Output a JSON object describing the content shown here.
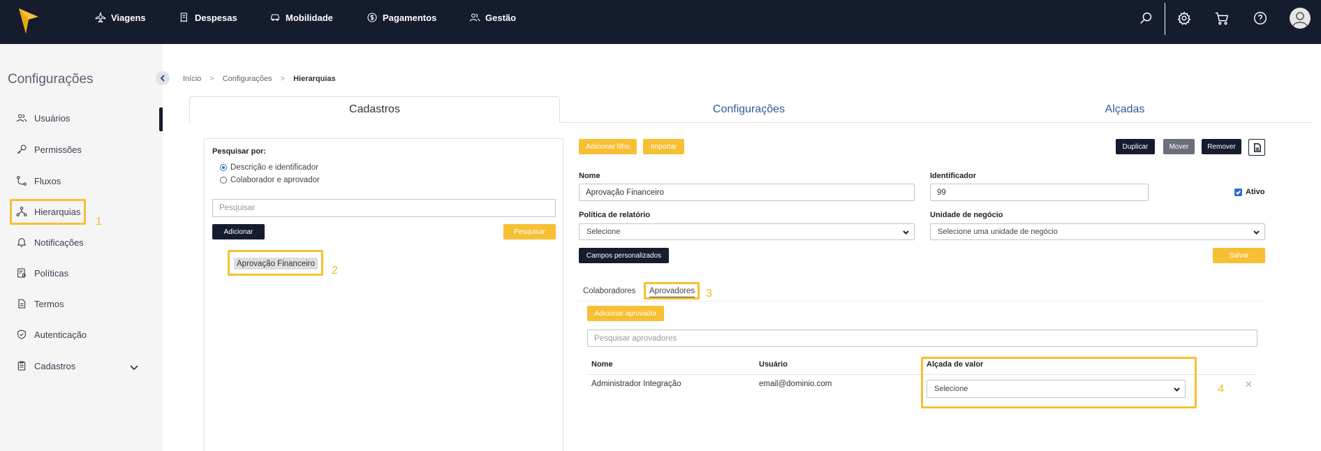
{
  "nav": {
    "items": [
      {
        "label": "Viagens",
        "icon": "airplane-icon"
      },
      {
        "label": "Despesas",
        "icon": "receipt-icon"
      },
      {
        "label": "Mobilidade",
        "icon": "car-icon"
      },
      {
        "label": "Pagamentos",
        "icon": "dollar-icon"
      },
      {
        "label": "Gestão",
        "icon": "users-icon"
      }
    ]
  },
  "sidebar": {
    "title": "Configurações",
    "items": [
      {
        "label": "Usuários",
        "icon": "users-icon"
      },
      {
        "label": "Permissões",
        "icon": "key-icon"
      },
      {
        "label": "Fluxos",
        "icon": "flow-icon"
      },
      {
        "label": "Hierarquias",
        "icon": "hierarchy-icon"
      },
      {
        "label": "Notificações",
        "icon": "bell-icon"
      },
      {
        "label": "Políticas",
        "icon": "policy-icon"
      },
      {
        "label": "Termos",
        "icon": "document-icon"
      },
      {
        "label": "Autenticação",
        "icon": "shield-icon"
      },
      {
        "label": "Cadastros",
        "icon": "registry-icon"
      }
    ]
  },
  "breadcrumb": {
    "home": "Início",
    "parent": "Configurações",
    "current": "Hierarquias"
  },
  "tabs": {
    "cadastros": "Cadastros",
    "configuracoes": "Configurações",
    "alcadas": "Alçadas"
  },
  "left": {
    "search_by": "Pesquisar por:",
    "radio1": "Descrição e identificador",
    "radio2": "Colaborador e aprovador",
    "search_placeholder": "Pesquisar",
    "add_button": "Adicionar",
    "search_button": "Pesquisar",
    "tree_node": "Aprovação Financeiro"
  },
  "actions": {
    "add_child": "Adicionar filho",
    "import": "Importar",
    "duplicate": "Duplicar",
    "move": "Mover",
    "remove": "Remover"
  },
  "form": {
    "name_label": "Nome",
    "name_value": "Aprovação Financeiro",
    "id_label": "Identificador",
    "id_value": "99",
    "active_label": "Ativo",
    "policy_label": "Política de relatório",
    "policy_value": "Selecione",
    "unit_label": "Unidade de negócio",
    "unit_value": "Selecione uma unidade de negócio",
    "custom_fields": "Campos personalizados",
    "save": "Salvar"
  },
  "subtabs": {
    "colaboradores": "Colaboradores",
    "aprovadores": "Aprovadores"
  },
  "approvers": {
    "add_button": "Adicionar aprovador",
    "search_placeholder": "Pesquisar aprovadores",
    "col_name": "Nome",
    "col_user": "Usuário",
    "col_alcada": "Alçada de valor",
    "rows": [
      {
        "name": "Administrador Integração",
        "user": "email@dominio.com",
        "alcada": "Selecione"
      }
    ]
  },
  "annotations": [
    "1",
    "2",
    "3",
    "4"
  ],
  "colors": {
    "navy": "#151c2e",
    "accent_yellow": "#f7bf33",
    "link_blue": "#2d5d98"
  }
}
